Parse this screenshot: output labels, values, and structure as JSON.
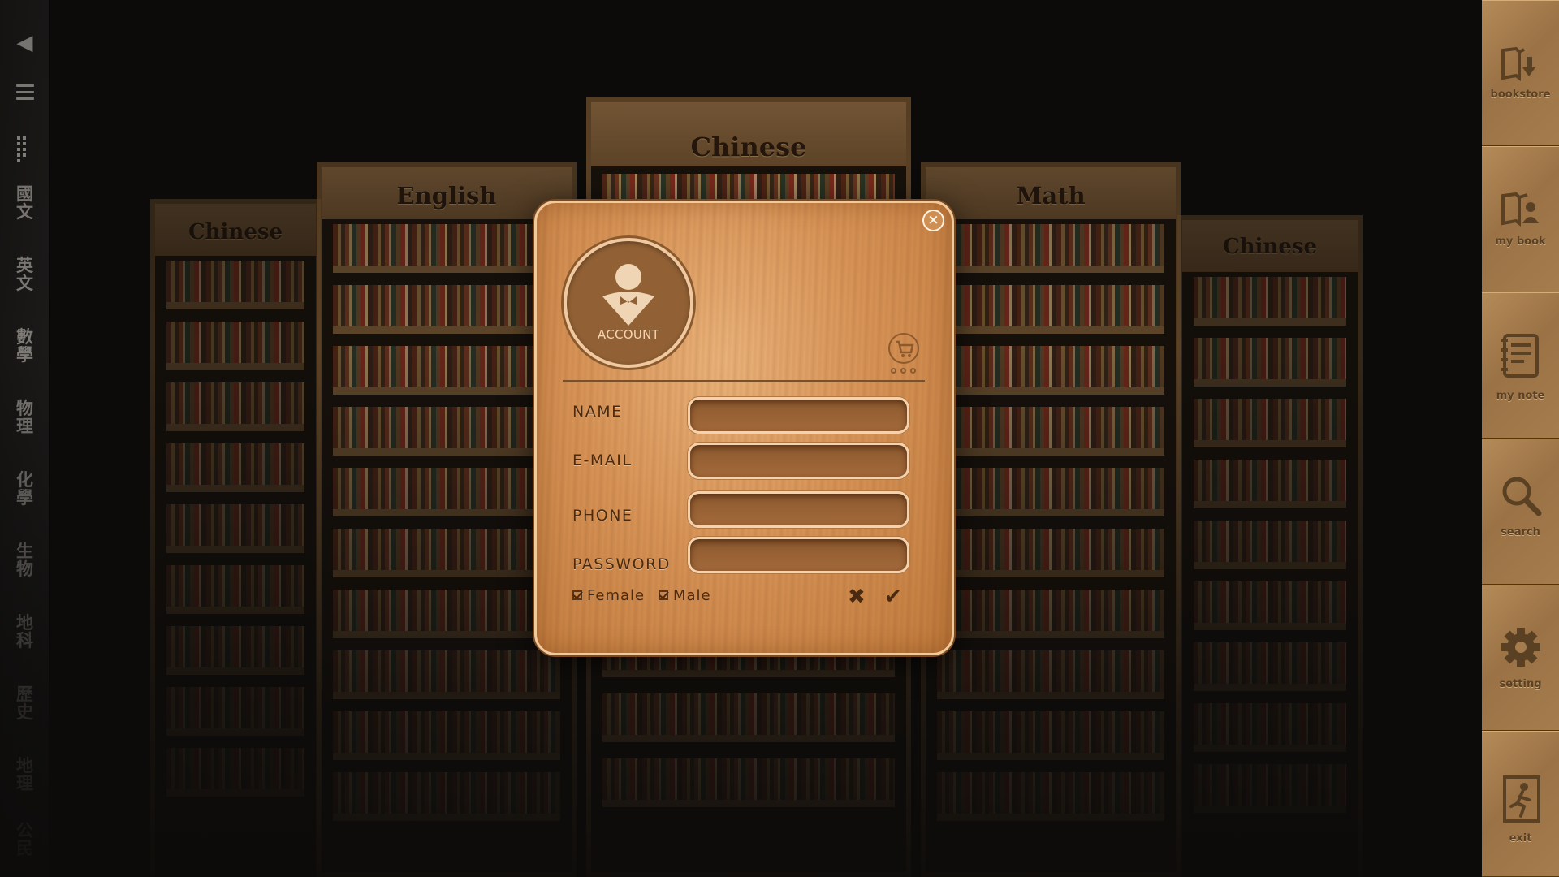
{
  "left_sidebar": {
    "back_icon": "back-arrow-icon",
    "menu_icon": "hamburger-menu-icon",
    "grid_icon": "grid-icon",
    "subjects": [
      "國\n文",
      "英\n文",
      "數\n學",
      "物\n理",
      "化\n學",
      "生\n物",
      "地\n科",
      "歷\n史",
      "地\n理",
      "公\n民"
    ]
  },
  "right_sidebar": {
    "items": [
      {
        "label": "bookstore",
        "icon": "book-download-icon"
      },
      {
        "label": "my book",
        "icon": "book-user-icon"
      },
      {
        "label": "my note",
        "icon": "notebook-icon"
      },
      {
        "label": "search",
        "icon": "search-icon"
      },
      {
        "label": "setting",
        "icon": "gear-icon"
      },
      {
        "label": "exit",
        "icon": "exit-door-icon"
      }
    ]
  },
  "shelves": [
    {
      "title": "Chinese"
    },
    {
      "title": "English"
    },
    {
      "title": "Chinese"
    },
    {
      "title": "Math"
    },
    {
      "title": "Chinese"
    }
  ],
  "dialog": {
    "close_icon": "close-icon",
    "account_label": "ACCOUNT",
    "cart_icon": "cart-icon",
    "fields": [
      {
        "label": "NAME",
        "value": ""
      },
      {
        "label": "E-MAIL",
        "value": ""
      },
      {
        "label": "PHONE",
        "value": ""
      },
      {
        "label": "PASSWORD",
        "value": ""
      }
    ],
    "gender": [
      {
        "label": "Female",
        "checked": true
      },
      {
        "label": "Male",
        "checked": true
      }
    ],
    "cancel_icon": "x-mark-icon",
    "confirm_icon": "checkmark-icon"
  },
  "colors": {
    "wood_light": "#e4aa72",
    "wood_dark": "#4a2a10",
    "sidebar_wood": "#a57c4d",
    "background": "#0c0b0a"
  }
}
